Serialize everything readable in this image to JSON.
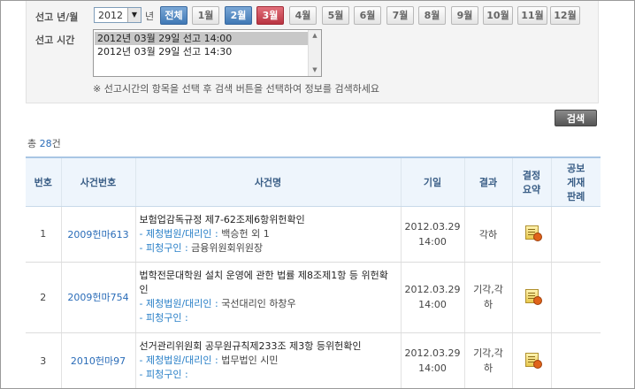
{
  "filter": {
    "year_label": "선고 년/월",
    "year_value": "2012",
    "year_unit": "년",
    "months": [
      "전체",
      "1월",
      "2월",
      "3월",
      "4월",
      "5월",
      "6월",
      "7월",
      "8월",
      "9월",
      "10월",
      "11월",
      "12월"
    ],
    "time_label": "선고 시간",
    "time_options": [
      "2012년 03월 29일 선고 14:00",
      "2012년 03월 29일 선고 14:30"
    ],
    "notice": "※ 선고시간의 항목을 선택 후 검색 버튼을 선택하여 정보를 검색하세요",
    "search_label": "검색"
  },
  "summary": {
    "prefix": "총 ",
    "count": "28",
    "suffix": "건"
  },
  "table": {
    "headers": [
      "번호",
      "사건번호",
      "사건명",
      "기일",
      "결과",
      "결정 요약",
      "공보 게재 판례"
    ],
    "rows": [
      {
        "no": "1",
        "case": "2009헌마613",
        "title": "보험업감독규정 제7-62조제6항위헌확인",
        "rep_label": "- 제청법원/대리인 : ",
        "rep": "백승헌 외 1",
        "pet_label": "- 피청구인 : ",
        "pet": "금융위원회위원장",
        "date": "2012.03.29",
        "time": "14:00",
        "result": "각하"
      },
      {
        "no": "2",
        "case": "2009헌마754",
        "title": "법학전문대학원 설치 운영에 관한 법률 제8조제1항 등 위헌확인",
        "rep_label": "- 제청법원/대리인 : ",
        "rep": "국선대리인 하창우",
        "pet_label": "- 피청구인 : ",
        "pet": "",
        "date": "2012.03.29",
        "time": "14:00",
        "result": "기각,각하"
      },
      {
        "no": "3",
        "case": "2010헌마97",
        "title": "선거관리위원회 공무원규칙제233조 제3항 등위헌확인",
        "rep_label": "- 제청법원/대리인 : ",
        "rep": "법무법인 시민",
        "pet_label": "- 피청구인 : ",
        "pet": "",
        "date": "2012.03.29",
        "time": "14:00",
        "result": "기각,각하"
      }
    ]
  },
  "colors": {
    "accent": "#3f78b5",
    "selected_month": "#b93441",
    "link": "#2a6cb8"
  }
}
